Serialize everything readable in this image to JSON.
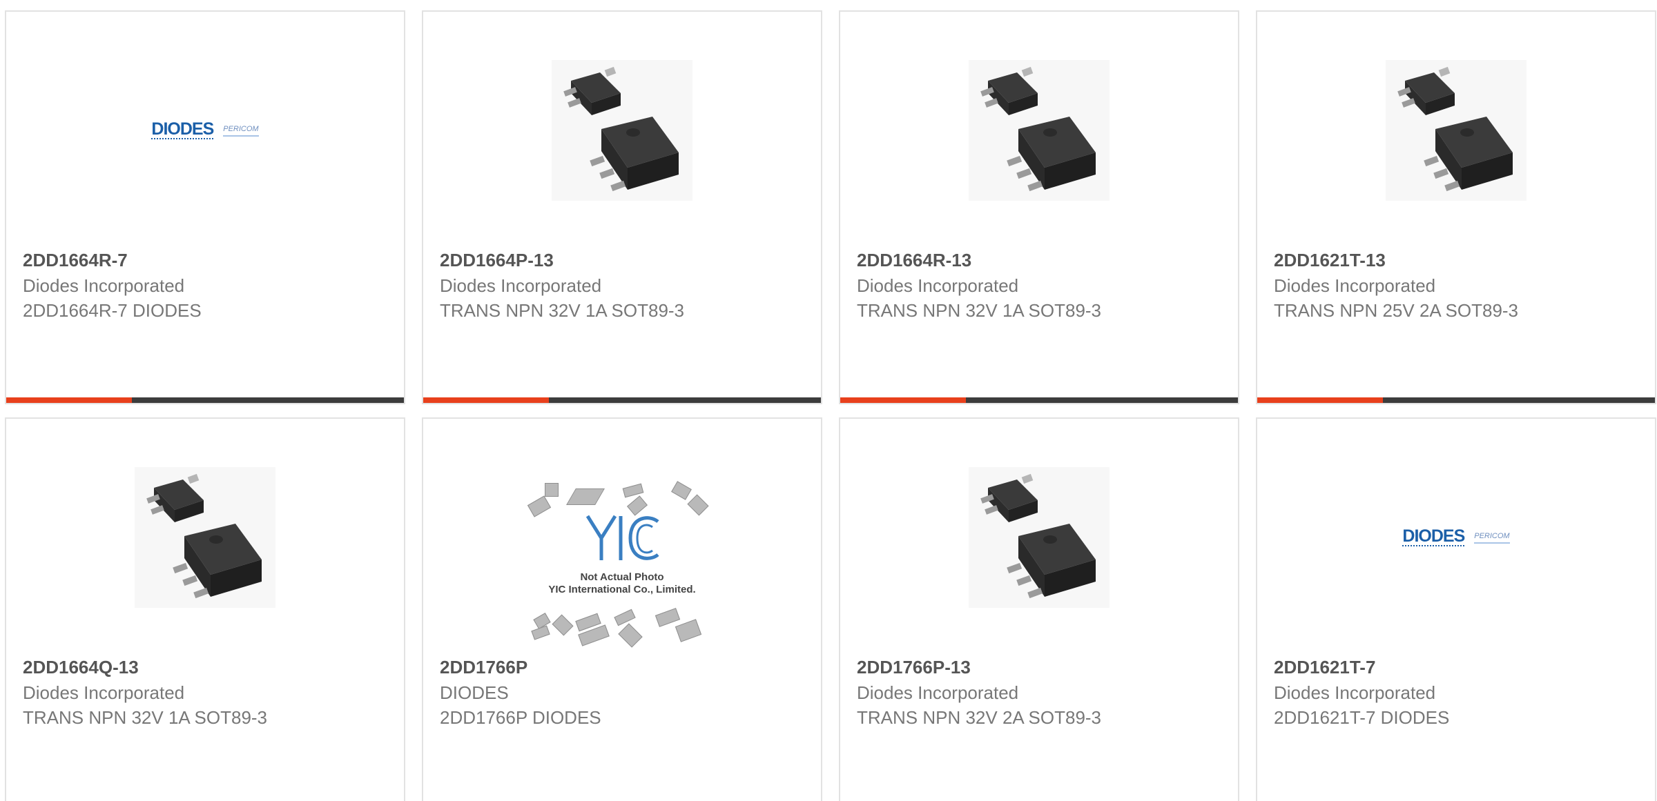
{
  "colors": {
    "accent": "#e8401c",
    "bar": "#3c3c3c",
    "border": "#e2e2e2",
    "part_text": "#555555",
    "sub_text": "#777777",
    "diodes_blue": "#1b5fa8"
  },
  "cards": [
    {
      "part_number": "2DD1664R-7",
      "manufacturer": "Diodes Incorporated",
      "description": "2DD1664R-7 DIODES",
      "image": "diodes-logo",
      "logo": {
        "brand": "DIODES",
        "sub": "PERICOM"
      }
    },
    {
      "part_number": "2DD1664P-13",
      "manufacturer": "Diodes Incorporated",
      "description": "TRANS NPN 32V 1A SOT89-3",
      "image": "sot89-package-photo"
    },
    {
      "part_number": "2DD1664R-13",
      "manufacturer": "Diodes Incorporated",
      "description": "TRANS NPN 32V 1A SOT89-3",
      "image": "sot89-package-photo"
    },
    {
      "part_number": "2DD1621T-13",
      "manufacturer": "Diodes Incorporated",
      "description": "TRANS NPN 25V 2A SOT89-3",
      "image": "sot89-package-photo"
    },
    {
      "part_number": "2DD1664Q-13",
      "manufacturer": "Diodes Incorporated",
      "description": "TRANS NPN 32V 1A SOT89-3",
      "image": "sot89-package-photo"
    },
    {
      "part_number": "2DD1766P",
      "manufacturer": "DIODES",
      "description": "2DD1766P DIODES",
      "image": "yic-placeholder",
      "placeholder": {
        "mark": "YIC",
        "line1": "Not Actual Photo",
        "line2": "YIC International Co., Limited."
      }
    },
    {
      "part_number": "2DD1766P-13",
      "manufacturer": "Diodes Incorporated",
      "description": "TRANS NPN 32V 2A SOT89-3",
      "image": "sot89-package-photo"
    },
    {
      "part_number": "2DD1621T-7",
      "manufacturer": "Diodes Incorporated",
      "description": "2DD1621T-7 DIODES",
      "image": "diodes-logo",
      "logo": {
        "brand": "DIODES",
        "sub": "PERICOM"
      }
    }
  ]
}
